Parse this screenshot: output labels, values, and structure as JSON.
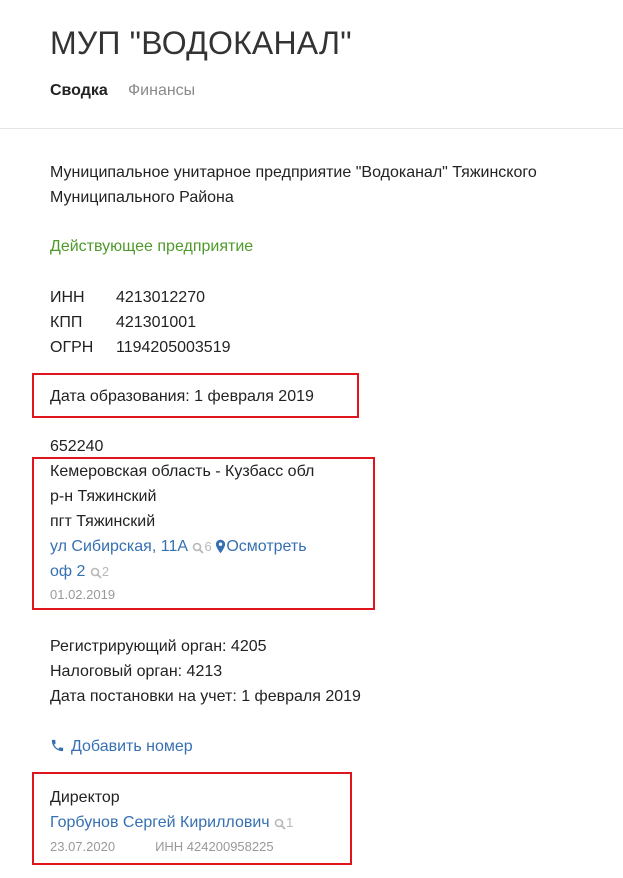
{
  "header": {
    "title": "МУП \"ВОДОКАНАЛ\"",
    "tabs": [
      {
        "label": "Сводка",
        "active": true
      },
      {
        "label": "Финансы",
        "active": false
      }
    ]
  },
  "company": {
    "full_name_line1": "Муниципальное унитарное предприятие \"Водоканал\" Тяжинского",
    "full_name_line2": "Муниципального Района",
    "status": "Действующее предприятие",
    "status_color": "#4e9a2a"
  },
  "requisites": [
    {
      "label": "ИНН",
      "value": "4213012270"
    },
    {
      "label": "КПП",
      "value": "421301001"
    },
    {
      "label": "ОГРН",
      "value": "1194205003519"
    }
  ],
  "registration": {
    "founded": "Дата образования: 1 февраля 2019"
  },
  "address": {
    "postcode": "652240",
    "region": "Кемеровская область - Кузбасс обл",
    "district": "р-н Тяжинский",
    "settlement": "пгт Тяжинский",
    "street": "ул Сибирская, 11А",
    "street_search_count": "6",
    "view_map_label": "Осмотреть",
    "office": "оф 2",
    "office_search_count": "2",
    "date": "01.02.2019"
  },
  "authorities": {
    "registering": "Регистрирующий орган: 4205",
    "tax": "Налоговый орган: 4213",
    "registration_date": "Дата постановки на учет: 1 февраля 2019"
  },
  "phone": {
    "add_label": "Добавить номер"
  },
  "director": {
    "role": "Директор",
    "name": "Горбунов Сергей Кириллович",
    "search_count": "1",
    "date": "23.07.2020",
    "inn": "ИНН 424200958225"
  },
  "colors": {
    "link": "#3670b2",
    "highlight_box": "#e0141c"
  }
}
